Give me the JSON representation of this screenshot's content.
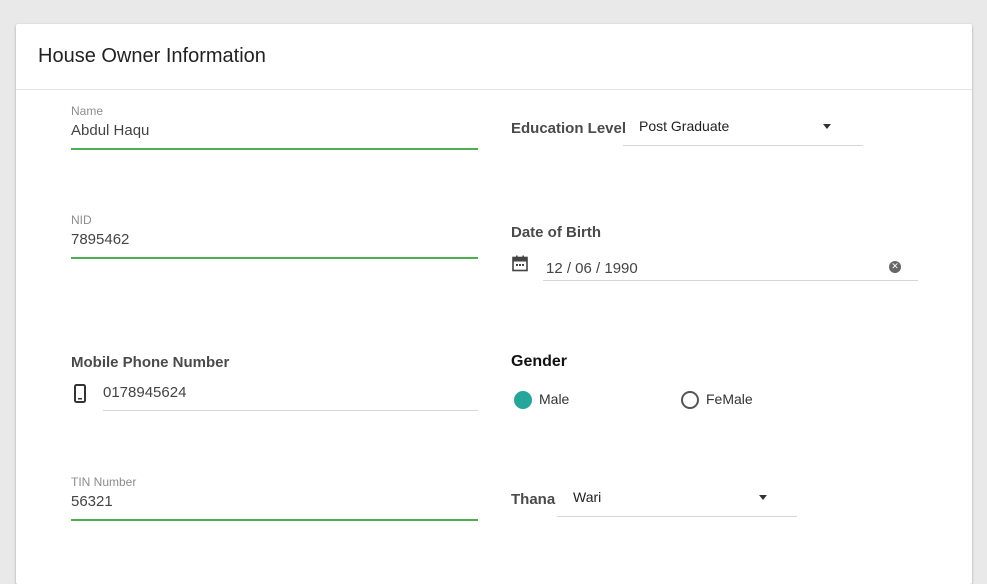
{
  "form": {
    "title": "House Owner Information",
    "name": {
      "label": "Name",
      "value": "Abdul Haqu"
    },
    "nid": {
      "label": "NID",
      "value": "7895462"
    },
    "mobile": {
      "label": "Mobile Phone Number",
      "value": "0178945624"
    },
    "tin": {
      "label": "TIN Number",
      "value": "56321"
    },
    "education": {
      "label": "Education Level",
      "value": "Post Graduate"
    },
    "dob": {
      "label": "Date of Birth",
      "value": "12 / 06 / 1990"
    },
    "gender": {
      "label": "Gender",
      "options": [
        {
          "label": "Male",
          "checked": true
        },
        {
          "label": "FeMale",
          "checked": false
        }
      ]
    },
    "thana": {
      "label": "Thana",
      "value": "Wari"
    }
  },
  "colors": {
    "accent_green": "#4caf50",
    "radio_teal": "#26a69a"
  },
  "icons": {
    "calendar": "calendar-icon",
    "clear": "clear-icon",
    "phone": "phone-icon",
    "dropdown": "dropdown-caret-icon"
  }
}
